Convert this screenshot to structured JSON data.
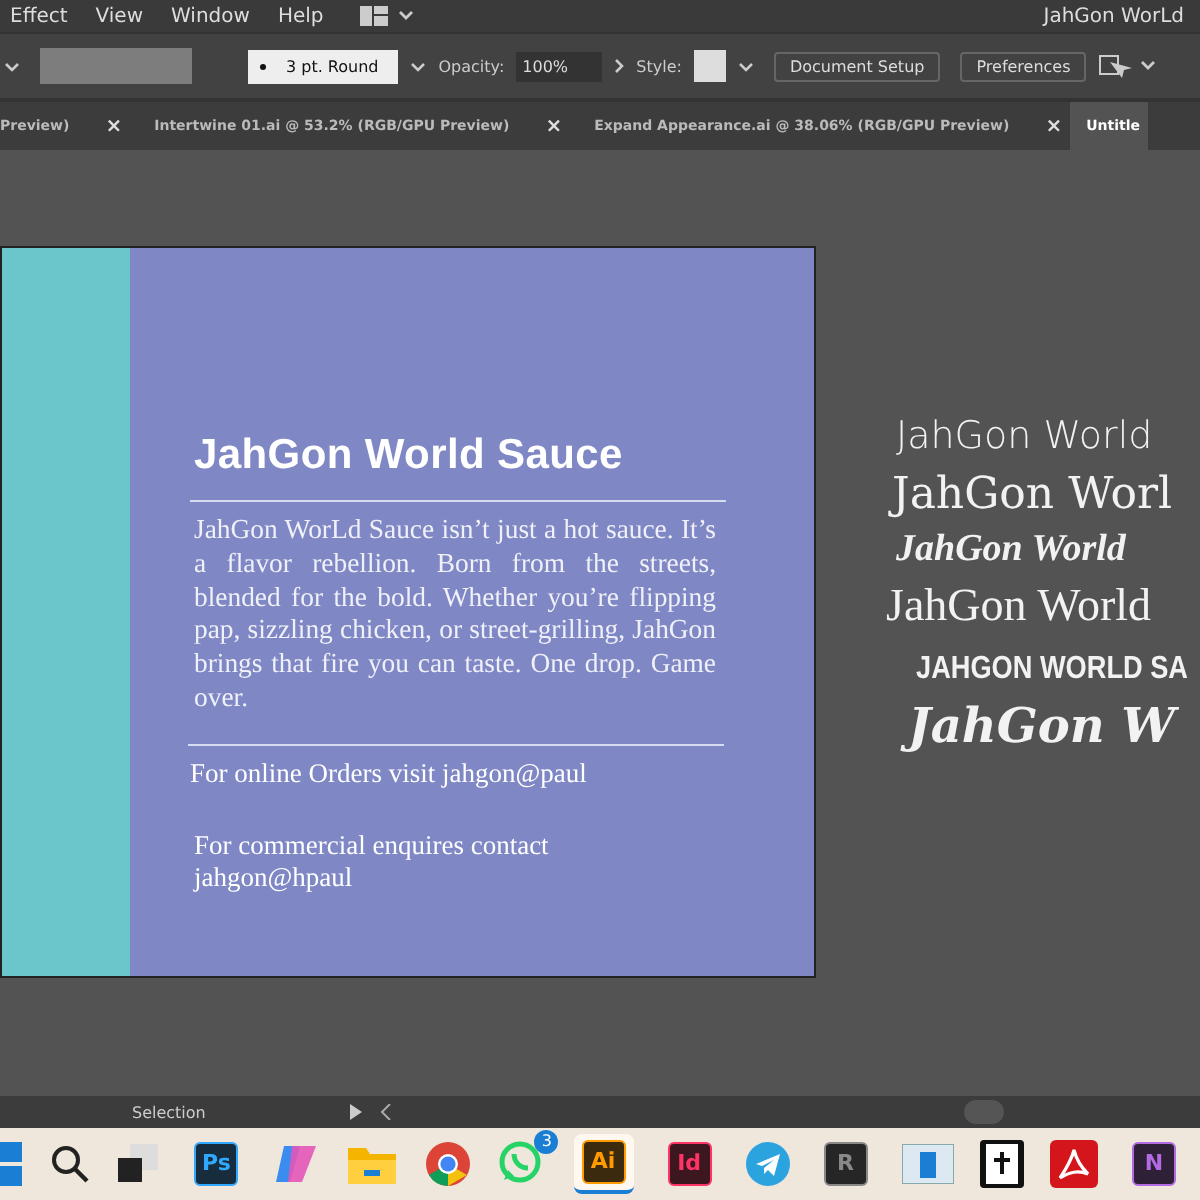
{
  "menu": {
    "items": [
      "Effect",
      "View",
      "Window",
      "Help"
    ],
    "workspace": "JahGon WorLd"
  },
  "control_bar": {
    "brush": "3 pt. Round",
    "opacity_label": "Opacity:",
    "opacity": "100%",
    "style_label": "Style:",
    "buttons": [
      "Document Setup",
      "Preferences"
    ]
  },
  "tabs": [
    {
      "label": "Preview)",
      "selected": false,
      "close": "×"
    },
    {
      "label": "Intertwine 01.ai @ 53.2% (RGB/GPU Preview)",
      "selected": false,
      "close": "×"
    },
    {
      "label": "Expand Appearance.ai @ 38.06% (RGB/GPU Preview)",
      "selected": false,
      "close": "×"
    },
    {
      "label": "Untitle",
      "selected": true
    }
  ],
  "artboard": {
    "title": "JahGon World Sauce",
    "body": "JahGon WorLd Sauce isn’t just a hot sauce. It’s a flavor rebellion. Born from the streets, blended for the bold. Whether you’re flipping pap, sizzling chicken, or street-grilling, JahGon brings that fire you can taste. One drop. Game over.",
    "orders": "For online Orders visit jahgon@paul",
    "commercial": "For commercial enquires contact jahgon@hpaul"
  },
  "font_samples": [
    {
      "kind": "sans",
      "text": "JahGon World"
    },
    {
      "kind": "serif",
      "text": "JahGon Worl"
    },
    {
      "kind": "blackletter",
      "text": "JahGon World"
    },
    {
      "kind": "serif-light",
      "text": "JahGon World"
    },
    {
      "kind": "condensed",
      "text": "JAHGON WORLD SA"
    },
    {
      "kind": "script",
      "text": "JahGon W"
    }
  ],
  "status_bar": {
    "tool": "Selection"
  },
  "taskbar": [
    {
      "kind": "start"
    },
    {
      "kind": "search"
    },
    {
      "kind": "taskview"
    },
    {
      "kind": "app",
      "label": "Ps",
      "color": "#31a8ff"
    },
    {
      "kind": "copilot"
    },
    {
      "kind": "folder"
    },
    {
      "kind": "chrome"
    },
    {
      "kind": "whatsapp",
      "badge": "3"
    },
    {
      "kind": "app",
      "label": "Ai",
      "color": "#ff9a00",
      "selected": true
    },
    {
      "kind": "app",
      "label": "Id",
      "color": "#ff3366"
    },
    {
      "kind": "telegram"
    },
    {
      "kind": "app",
      "label": "R",
      "color": "#888888"
    },
    {
      "kind": "window"
    },
    {
      "kind": "bible"
    },
    {
      "kind": "acrobat"
    },
    {
      "kind": "app",
      "label": "N",
      "color": "#b36ae2"
    }
  ]
}
